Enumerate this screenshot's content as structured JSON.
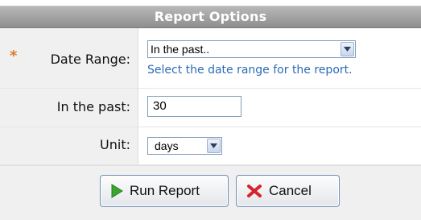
{
  "header": {
    "title": "Report Options"
  },
  "form": {
    "date_range": {
      "required_marker": "*",
      "label": "Date Range:",
      "selected": "In the past..",
      "hint": "Select the date range for the report."
    },
    "in_the_past": {
      "label": "In the past:",
      "value": "30"
    },
    "unit": {
      "label": "Unit:",
      "selected": "days"
    }
  },
  "buttons": {
    "run": {
      "label": "Run Report",
      "icon": "play-icon"
    },
    "cancel": {
      "label": "Cancel",
      "icon": "cancel-x-icon"
    }
  },
  "colors": {
    "header_bg": "#9c9c9c",
    "hint_text": "#2a6bb8",
    "required": "#e07a1f",
    "run_icon": "#3aa52f",
    "cancel_icon": "#d8232a"
  }
}
